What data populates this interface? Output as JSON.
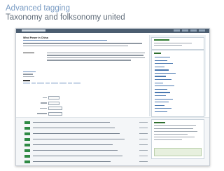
{
  "slide": {
    "title": "Advanced tagging",
    "subtitle": "Taxonomy and folksonomy united"
  },
  "screenshot": {
    "heading": "Wind Power in China",
    "colors": {
      "topbar": "#4b5d70",
      "accent_green": "#2f8a44",
      "link_blue": "#4a78b0",
      "sidebar_bg": "#eef2f5"
    },
    "tag_cloud_item_count": 18,
    "result_row_count": 8
  }
}
